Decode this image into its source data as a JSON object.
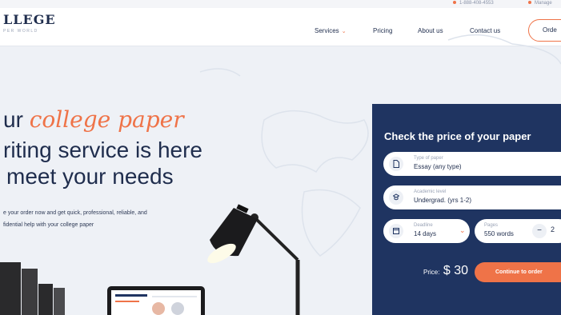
{
  "top_bar": {
    "phone": "1-888-408-4553",
    "manage": "Manage"
  },
  "header": {
    "logo": {
      "name": "LLEGE",
      "tagline": "PER WORLD"
    },
    "nav": [
      {
        "label": "Services",
        "has_dropdown": true
      },
      {
        "label": "Pricing"
      },
      {
        "label": "About us"
      },
      {
        "label": "Contact us"
      }
    ],
    "order_button": "Orde"
  },
  "hero": {
    "line1_prefix": "ur ",
    "line1_accent": "college paper",
    "line2": "riting service is here",
    "line3": "meet your needs",
    "subtitle1": "e your order now and get quick, professional, reliable, and",
    "subtitle2": "fidential help with your college paper"
  },
  "price_form": {
    "title": "Check the price of your paper",
    "type_of_paper": {
      "label": "Type of paper",
      "value": "Essay (any type)",
      "icon": "document-icon"
    },
    "academic_level": {
      "label": "Academic level",
      "value": "Undergrad. (yrs 1-2)",
      "icon": "graduation-cap-icon"
    },
    "deadline": {
      "label": "Deadline",
      "value": "14 days",
      "icon": "calendar-icon"
    },
    "pages": {
      "label": "Pages",
      "value": "550 words",
      "stepper_minus": "−",
      "count": "2"
    },
    "price_label": "Price:",
    "price_value": "$ 30",
    "continue_button": "Continue to order"
  },
  "colors": {
    "accent": "#ef7348",
    "navy": "#1f3461",
    "text": "#1f2d4d",
    "background": "#eef1f6"
  }
}
